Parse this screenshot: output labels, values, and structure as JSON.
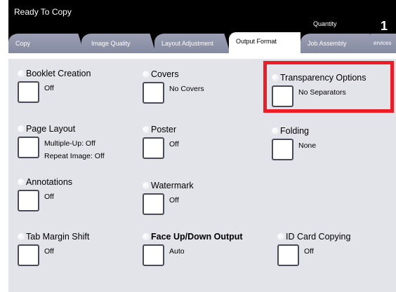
{
  "header": {
    "status": "Ready To Copy",
    "quantity_label": "Quantity",
    "quantity_value": "1"
  },
  "tabs": [
    {
      "label": "Copy"
    },
    {
      "label": "Image Quality"
    },
    {
      "label": "Layout Adjustment"
    },
    {
      "label": "Output Format"
    },
    {
      "label": "Job Assembly"
    },
    {
      "label": "ervices"
    }
  ],
  "options": {
    "booklet": {
      "title": "Booklet Creation",
      "value": "Off"
    },
    "covers": {
      "title": "Covers",
      "value": "No Covers"
    },
    "transparency": {
      "title": "Transparency Options",
      "value": "No Separators"
    },
    "page_layout": {
      "title": "Page Layout",
      "value1": "Multiple-Up: Off",
      "value2": "Repeat Image: Off"
    },
    "poster": {
      "title": "Poster",
      "value": "Off"
    },
    "folding": {
      "title": "Folding",
      "value": "None"
    },
    "annotations": {
      "title": "Annotations",
      "value": "Off"
    },
    "watermark": {
      "title": "Watermark",
      "value": "Off"
    },
    "tab_margin": {
      "title": "Tab Margin Shift",
      "value": "Off"
    },
    "face_up_down": {
      "title": "Face Up/Down Output",
      "value": "Auto"
    },
    "id_card": {
      "title": "ID Card Copying",
      "value": "Off"
    }
  },
  "colors": {
    "highlight": "#ee1c24",
    "tab_inactive": "#9c9fb4",
    "panel": "#e3e3ea"
  }
}
